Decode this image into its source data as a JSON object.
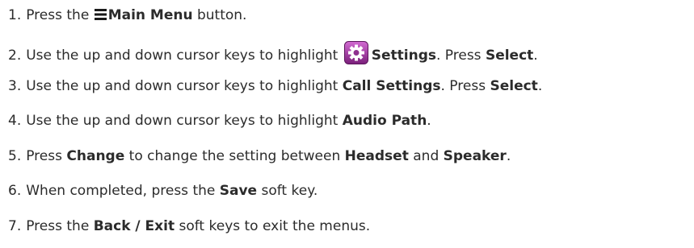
{
  "steps": [
    {
      "num": "1.",
      "parts": [
        "Press the",
        "Main Menu",
        "button."
      ]
    },
    {
      "num": "2.",
      "parts": [
        "Use the up and down cursor keys to highlight",
        "Settings",
        ". Press",
        "Select",
        "."
      ]
    },
    {
      "num": "3.",
      "parts": [
        "Use the up and down cursor keys to highlight",
        "Call Settings",
        ". Press",
        "Select",
        "."
      ]
    },
    {
      "num": "4.",
      "parts": [
        "Use the up and down cursor keys to highlight",
        "Audio Path",
        "."
      ]
    },
    {
      "num": "5.",
      "parts": [
        "Press",
        "Change",
        "to change the setting between",
        "Headset",
        "and",
        "Speaker",
        "."
      ]
    },
    {
      "num": "6.",
      "parts": [
        "When completed, press the",
        "Save",
        "soft key."
      ]
    },
    {
      "num": "7.",
      "parts": [
        "Press the",
        "Back / Exit",
        "soft keys to exit the menus."
      ]
    }
  ],
  "icons": {
    "main_menu": "hamburger-menu-icon",
    "settings": "settings-gear-icon",
    "settings_color": "#8e2f8e",
    "settings_highlight": "#d26bd2"
  }
}
